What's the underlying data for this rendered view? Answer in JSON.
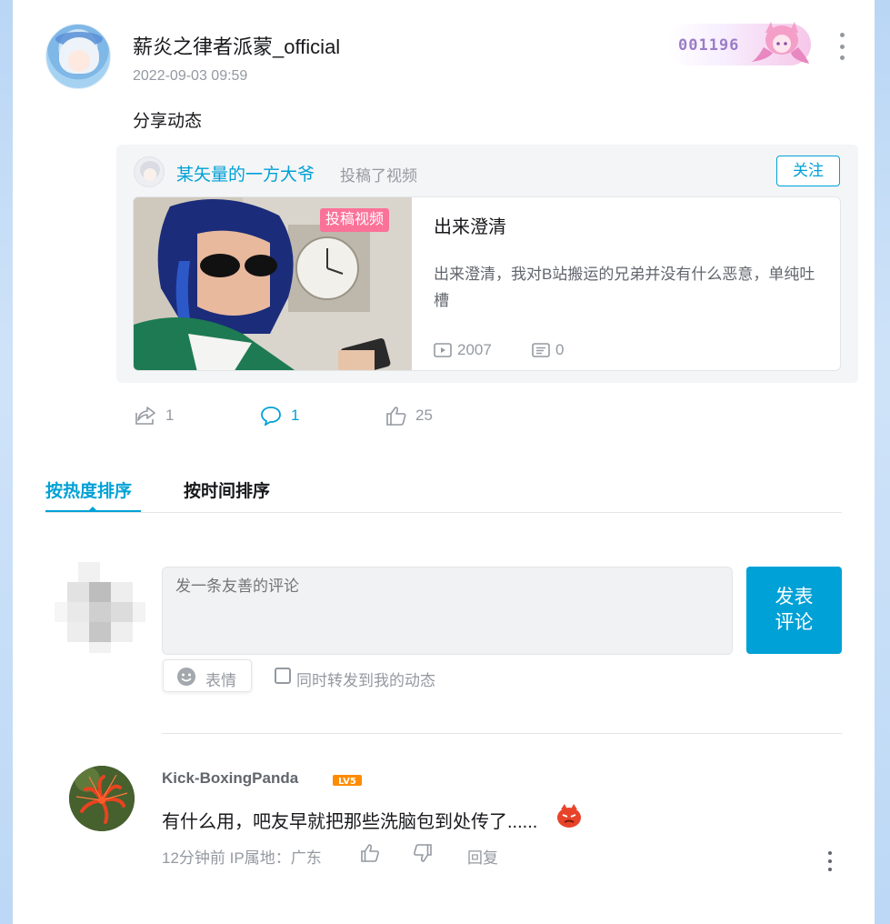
{
  "post": {
    "username": "薪炎之律者派蒙_official",
    "timestamp": "2022-09-03 09:59",
    "fan_badge_number": "001196",
    "text": "分享动态"
  },
  "repost": {
    "author": "某矢量的一方大爷",
    "action": "投稿了视频",
    "follow_label": "关注",
    "video": {
      "tag": "投稿视频",
      "title": "出来澄清",
      "description": "出来澄清，我对B站搬运的兄弟并没有什么恶意，单纯吐槽",
      "play_count": "2007",
      "danmaku_count": "0"
    }
  },
  "actions": {
    "share_count": "1",
    "comment_count": "1",
    "like_count": "25"
  },
  "sort_tabs": {
    "hot": "按热度排序",
    "time": "按时间排序"
  },
  "composer": {
    "placeholder": "发一条友善的评论",
    "post_label": "发表评论",
    "emoji_label": "表情",
    "forward_label": "同时转发到我的动态"
  },
  "reply": {
    "username": "Kick-BoxingPanda",
    "level": "LV5",
    "text": "有什么用，吧友早就把那些洗脑包到处传了......",
    "time_location": "12分钟前  IP属地：广东",
    "reply_label": "回复"
  },
  "colors": {
    "accent": "#00a1d6",
    "tag_pink": "#fb7299",
    "muted": "#9499a0"
  }
}
